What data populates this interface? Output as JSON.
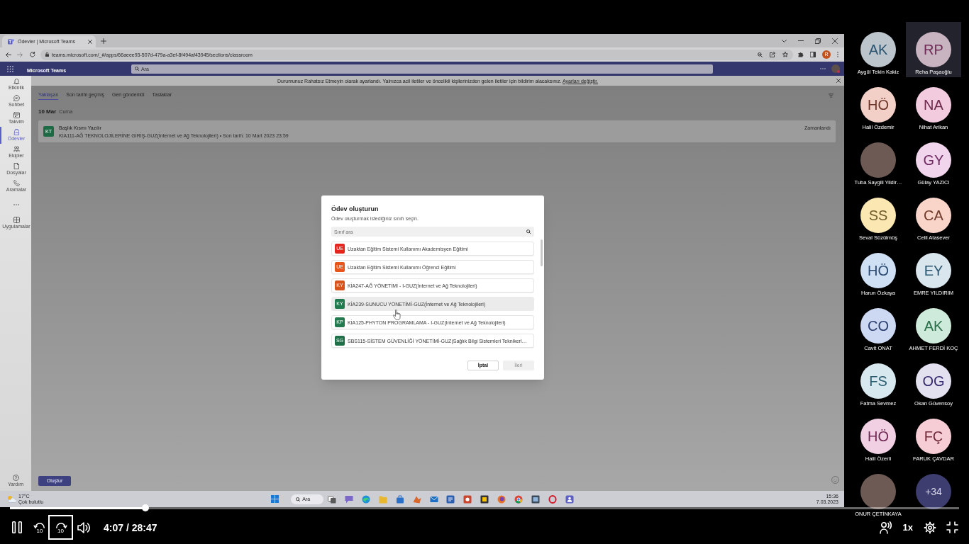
{
  "browser": {
    "tab": {
      "title": "Ödevler | Microsoft Teams",
      "selected": true
    },
    "url": "teams.microsoft.com/_#/apps/66aeee93-507d-479a-a3ef-8f494af43945/sections/classroom",
    "profile_initial": "R"
  },
  "teams_header": {
    "app_name": "Microsoft Teams",
    "search": {
      "placeholder": "Ara"
    }
  },
  "notification": {
    "text": "Durumunuz Rahatsız Etmeyin olarak ayarlandı. Yalnızca acil iletiler ve öncelikli kişilerinizden gelen iletiler için bildirim alacaksınız.",
    "link": "Ayarları değiştir."
  },
  "sidebar": {
    "items": [
      {
        "kind": "app",
        "label": "Etkinlik",
        "selected": false
      },
      {
        "kind": "app",
        "label": "Sohbet",
        "selected": false
      },
      {
        "kind": "app",
        "label": "Takvim",
        "selected": false
      },
      {
        "kind": "app",
        "label": "Ödevler",
        "selected": true
      },
      {
        "kind": "app",
        "label": "Ekipler",
        "selected": false
      },
      {
        "kind": "app",
        "label": "Dosyalar",
        "selected": false
      },
      {
        "kind": "app",
        "label": "Aramalar",
        "selected": false
      },
      {
        "kind": "more",
        "selected": false
      },
      {
        "kind": "app",
        "label": "Uygulamalar",
        "selected": false
      }
    ],
    "help": {
      "label": "Yardım"
    }
  },
  "assignments": {
    "tabs": [
      {
        "label": "Yaklaşan",
        "selected": true
      },
      {
        "label": "Son tarihi geçmiş",
        "selected": false
      },
      {
        "label": "Geri gönderildi",
        "selected": false
      },
      {
        "label": "Taslaklar",
        "selected": false
      }
    ],
    "date": {
      "day": "10 Mar",
      "weekday": "Cuma"
    },
    "items": [
      {
        "badge": "KT",
        "color": "#1d6b45",
        "title": "Başlık Kısmı Yazılır",
        "details": "KİA111-AĞ TEKNOLOJİLERİNE GİRİŞ-GUZ(İnternet ve Ağ Teknolojileri) • Son tarih: 10 Mart 2023 23:59",
        "status": "Zamanlandı"
      }
    ],
    "create_button": "Oluştur"
  },
  "dialog": {
    "title": "Ödev oluşturun",
    "subtitle": "Ödev oluşturmak istediğiniz sınıfı seçin.",
    "search": {
      "placeholder": "Sınıf ara"
    },
    "classes": [
      {
        "badge": "UE",
        "color": "#e5261f",
        "name": "Uzaktan Eğitim Sistemi Kullanımı Akademisyen Eğitimi",
        "selected": false
      },
      {
        "badge": "UE",
        "color": "#e6561a",
        "name": "Uzaktan Eğitim Sistemi Kullanımı Öğrenci Eğitimi",
        "selected": false
      },
      {
        "badge": "KY",
        "color": "#d9541c",
        "name": "KİA247-AĞ YÖNETİMİ - I-GUZ(İnternet ve Ağ Teknolojileri)",
        "selected": false
      },
      {
        "badge": "KY",
        "color": "#237a4e",
        "name": "KİA239-SUNUCU YÖNETİMİ-GUZ(İnternet ve Ağ Teknolojileri)",
        "selected": true
      },
      {
        "badge": "KP",
        "color": "#237a4e",
        "name": "KİA125-PHYTON PROGRAMLAMA - I-GUZ(İnternet ve Ağ Teknolojileri)",
        "selected": false
      },
      {
        "badge": "SG",
        "color": "#1f7048",
        "name": "SBS115-SİSTEM GÜVENLİĞİ YÖNETİMİ-GUZ(Sağlık Bilgi Sistemleri Teknikerl…",
        "selected": false
      }
    ],
    "buttons": [
      {
        "label": "İptal",
        "disabled": false
      },
      {
        "label": "İleri",
        "disabled": true
      }
    ]
  },
  "taskbar": {
    "weather": {
      "temperature": "17°C",
      "condition": "Çok bulutlu"
    },
    "search": {
      "label": "Ara"
    },
    "clock": {
      "time": "15:36",
      "date": "7.03.2023"
    }
  },
  "participants": {
    "rows": [
      {
        "tiles": [
          {
            "kind": "initials",
            "name": "Aygül Tekin Kakiz",
            "initials": "AK",
            "color": "#bcc5cb",
            "highlighted": false
          },
          {
            "kind": "initials",
            "name": "Reha Paşaoğlu",
            "initials": "RP",
            "color": "#c8b3c0",
            "highlighted": true
          }
        ]
      },
      {
        "tiles": [
          {
            "kind": "initials",
            "name": "Halil Özdemir",
            "initials": "HÖ",
            "color": "#f2d0c8",
            "highlighted": false
          },
          {
            "kind": "initials",
            "name": "Nihat Arikan",
            "initials": "NA",
            "color": "#f3cbdf",
            "highlighted": false
          }
        ]
      },
      {
        "tiles": [
          {
            "kind": "photo",
            "name": "Tuba Saygili Yildir…",
            "highlighted": false
          },
          {
            "kind": "initials",
            "name": "Gülay YAZICI",
            "initials": "GY",
            "color": "#f1d5ec",
            "highlighted": false
          }
        ]
      },
      {
        "tiles": [
          {
            "kind": "initials",
            "name": "Seval Süzülmüş",
            "initials": "SS",
            "color": "#fbe7b2",
            "highlighted": false
          },
          {
            "kind": "initials",
            "name": "Celil Atasever",
            "initials": "CA",
            "color": "#f9d4c9",
            "highlighted": false
          }
        ]
      },
      {
        "tiles": [
          {
            "kind": "initials",
            "name": "Harun Özkaya",
            "initials": "HÖ",
            "color": "#cfe0f5",
            "highlighted": false
          },
          {
            "kind": "initials",
            "name": "EMRE YILDIRIM",
            "initials": "EY",
            "color": "#d9e6ee",
            "highlighted": false
          }
        ]
      },
      {
        "tiles": [
          {
            "kind": "initials",
            "name": "Cavit ONAT",
            "initials": "CO",
            "color": "#cdd8f2",
            "highlighted": false
          },
          {
            "kind": "initials",
            "name": "AHMET FERDİ KOÇ",
            "initials": "AK",
            "color": "#cdeada",
            "highlighted": false
          }
        ]
      },
      {
        "tiles": [
          {
            "kind": "initials",
            "name": "Fatma Sevmez",
            "initials": "FS",
            "color": "#d7e8ee",
            "highlighted": false
          },
          {
            "kind": "initials",
            "name": "Okan Güvensoy",
            "initials": "OG",
            "color": "#e3e0f0",
            "highlighted": false
          }
        ]
      },
      {
        "tiles": [
          {
            "kind": "initials",
            "name": "Halil Özerli",
            "initials": "HÖ",
            "color": "#f1d0e4",
            "highlighted": false
          },
          {
            "kind": "initials",
            "name": "FARUK ÇAVDAR",
            "initials": "FÇ",
            "color": "#f6cdd5",
            "highlighted": false
          }
        ]
      },
      {
        "tiles": [
          {
            "kind": "photo",
            "name": "ONUR ÇETİNKAYA",
            "highlighted": false
          },
          {
            "kind": "overflow",
            "label": "+34",
            "color": "#3d3d70",
            "highlighted": false
          }
        ]
      }
    ]
  },
  "player": {
    "progress": {
      "level": 0.143
    },
    "skip_back": {
      "label": "10",
      "focused": false
    },
    "skip_forward": {
      "label": "10",
      "focused": true
    },
    "time": "4:07 / 28:47",
    "speed": "1x"
  }
}
